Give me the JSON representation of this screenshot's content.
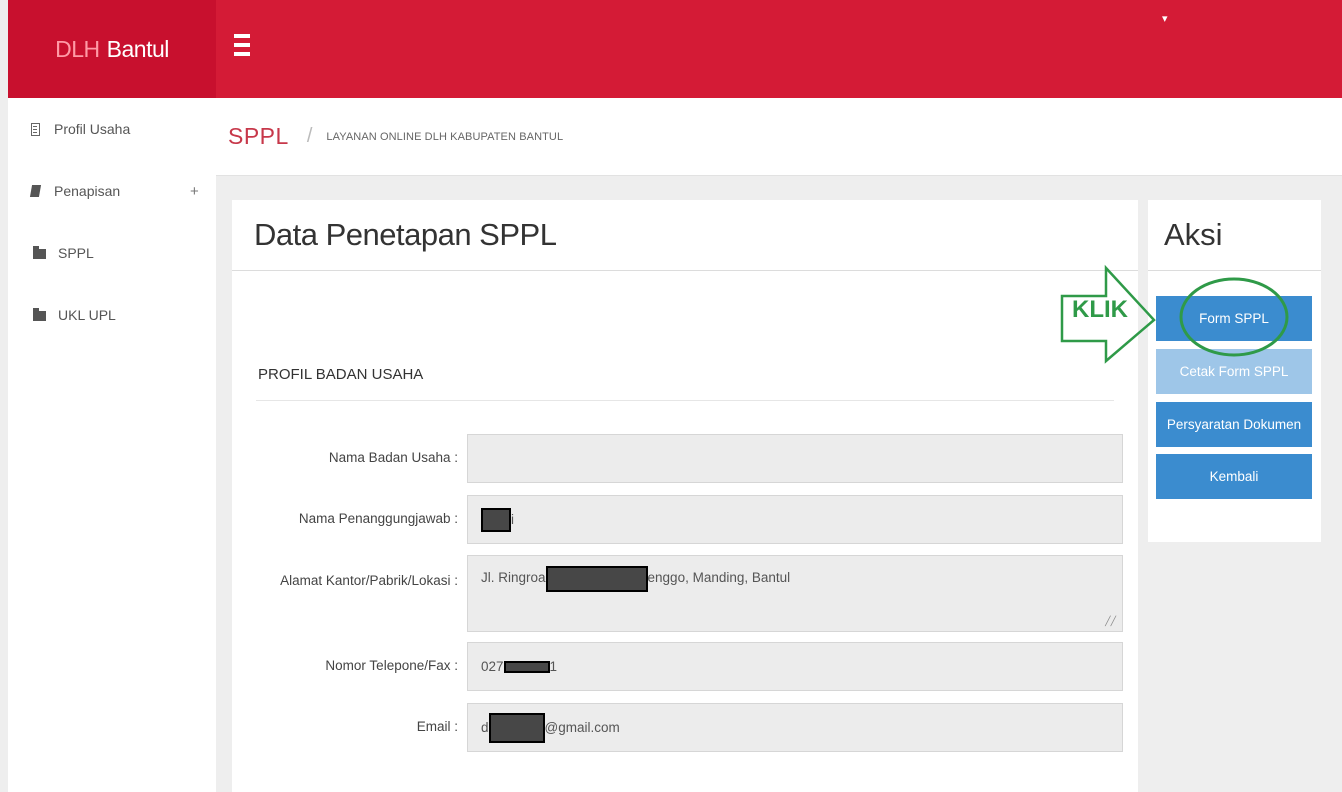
{
  "brand": {
    "part1": "DLH",
    "part2": "Bantul"
  },
  "sidebar": {
    "items": [
      {
        "label": "Profil Usaha",
        "icon": "document-icon"
      },
      {
        "label": "Penapisan",
        "icon": "book-icon",
        "expand": "+"
      },
      {
        "label": "SPPL",
        "icon": "folder-icon"
      },
      {
        "label": "UKL UPL",
        "icon": "folder-icon"
      }
    ]
  },
  "breadcrumb": {
    "title": "SPPL",
    "separator": "/",
    "subtitle": "LAYANAN ONLINE DLH KABUPATEN BANTUL"
  },
  "main": {
    "title": "Data Penetapan SPPL",
    "section": "PROFIL BADAN USAHA",
    "fields": [
      {
        "label": "Nama Badan Usaha :",
        "value_before": "",
        "value_after": ""
      },
      {
        "label": "Nama Penanggungjawab :",
        "value_before": "",
        "value_after": "i"
      },
      {
        "label": "Alamat Kantor/Pabrik/Lokasi :",
        "value_before": "Jl. Ringroa",
        "value_after": "enggo, Manding, Bantul"
      },
      {
        "label": "Nomor Telepone/Fax :",
        "value_before": "027",
        "value_after": "1"
      },
      {
        "label": "Email :",
        "value_before": "d",
        "value_after": "@gmail.com"
      }
    ]
  },
  "aksi": {
    "title": "Aksi",
    "buttons": [
      {
        "label": "Form SPPL"
      },
      {
        "label": "Cetak Form SPPL"
      },
      {
        "label": "Persyaratan Dokumen"
      },
      {
        "label": "Kembali"
      }
    ]
  },
  "annotation": {
    "label": "KLIK",
    "color": "#2f9a48"
  },
  "colors": {
    "brand": "#c8102e",
    "topbar": "#d41b36",
    "button": "#3b8ccf",
    "button_light": "#9ec6e8",
    "redaction": "#474747"
  }
}
